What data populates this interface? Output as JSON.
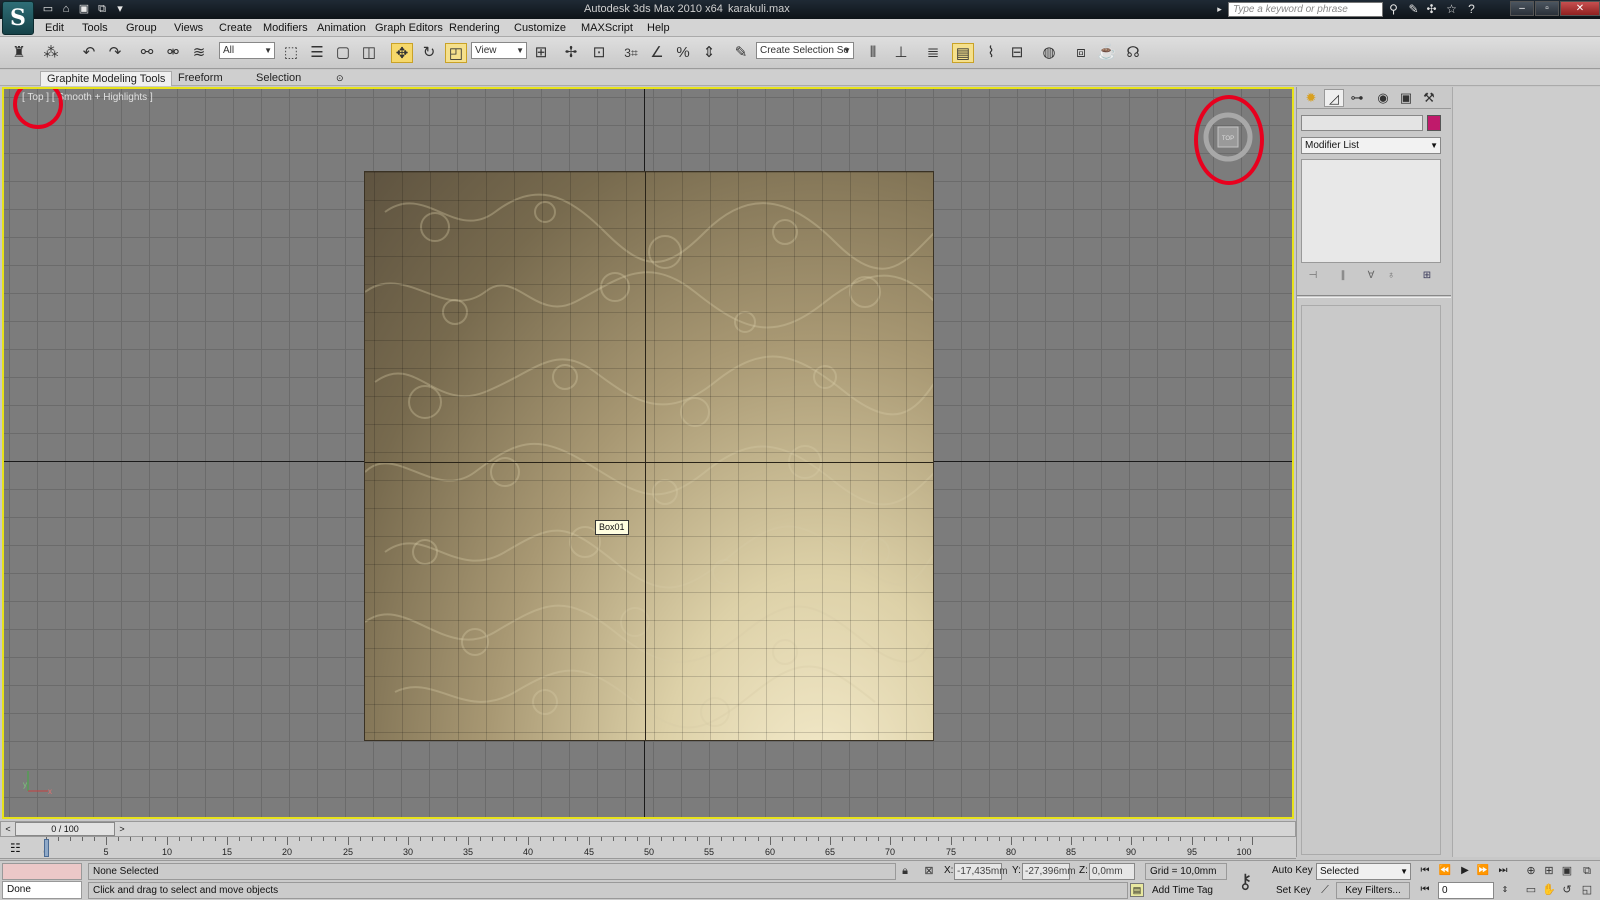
{
  "titlebar": {
    "app_title": "Autodesk 3ds Max  2010 x64",
    "file_name": "karakuli.max",
    "search_placeholder": "Type a keyword or phrase",
    "logo_glyph": "S",
    "quick_access_icons": [
      "new-file-icon",
      "open-file-icon",
      "save-icon",
      "project-folder-icon",
      "dropdown-icon"
    ]
  },
  "menu": [
    "Edit",
    "Tools",
    "Group",
    "Views",
    "Create",
    "Modifiers",
    "Animation",
    "Graph Editors",
    "Rendering",
    "Customize",
    "MAXScript",
    "Help"
  ],
  "toolbar": {
    "selection_filter": "All",
    "reference_coord": "View",
    "named_selection_placeholder": "Create Selection Se",
    "snap_label": "3",
    "active_tool": "select-and-move"
  },
  "ribbon": {
    "tabs": [
      "Graphite Modeling Tools",
      "Freeform",
      "Selection"
    ],
    "active_tab": "Graphite Modeling Tools"
  },
  "viewport": {
    "label": "[ Top ] [ Smooth + Highlights ]",
    "object_tooltip": "Box01",
    "viewcube_face": "TOP",
    "tripod_labels": [
      "y",
      "x"
    ],
    "border_color": "#e7e21a",
    "annotation_color": "#e8001e"
  },
  "command_panel": {
    "tab_icons": [
      "create-icon",
      "modify-icon",
      "hierarchy-icon",
      "motion-icon",
      "display-icon",
      "utilities-icon"
    ],
    "active_tab": "modify",
    "object_name": "",
    "object_color": "#c01a6b",
    "modifier_list": "Modifier List"
  },
  "time_slider": {
    "position": "0 / 100",
    "prev": "<",
    "next": ">"
  },
  "trackbar": {
    "labels": [
      "0",
      "5",
      "10",
      "15",
      "20",
      "25",
      "30",
      "35",
      "40",
      "45",
      "50",
      "55",
      "60",
      "65",
      "70",
      "75",
      "80",
      "85",
      "90",
      "95",
      "100"
    ]
  },
  "status": {
    "listener_output": "Done",
    "selection": "None Selected",
    "prompt": "Click and drag to select and move objects",
    "x_label": "X:",
    "x_value": "-17,435mm",
    "y_label": "Y:",
    "y_value": "-27,396mm",
    "z_label": "Z:",
    "z_value": "0,0mm",
    "grid": "Grid = 10,0mm",
    "add_time_tag": "Add Time Tag",
    "auto_key": "Auto Key",
    "set_key": "Set Key",
    "key_mode": "Selected",
    "key_filters": "Key Filters...",
    "current_frame": "0"
  }
}
